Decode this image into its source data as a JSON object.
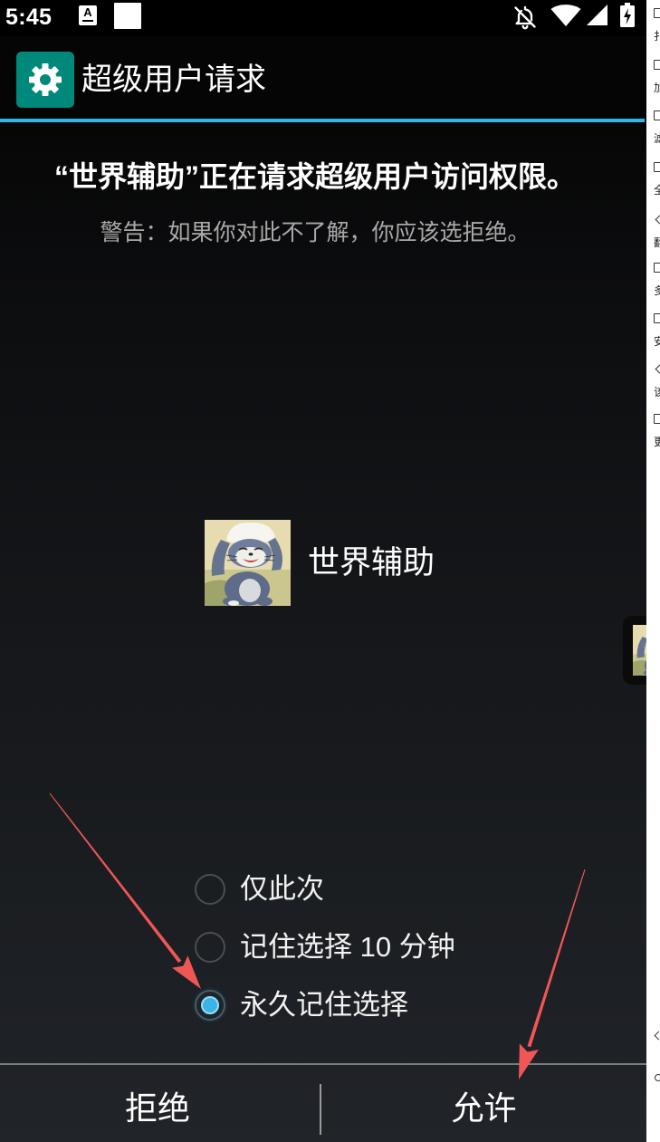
{
  "status_bar": {
    "time": "5:45",
    "notification_badge_letter": "A",
    "icons": [
      "a-text-icon",
      "white-square-icon",
      "bell-off-icon",
      "wifi-icon",
      "signal-icon",
      "battery-charging-icon"
    ]
  },
  "header": {
    "icon": "gear-icon",
    "title": "超级用户请求"
  },
  "request": {
    "heading": "“世界辅助”正在请求超级用户访问权限。",
    "warning": "警告：如果你对此不了解，你应该选拒绝。"
  },
  "app": {
    "icon": "cartoon-cat-app-icon",
    "name": "世界辅助"
  },
  "remember_options": [
    {
      "label": "仅此次",
      "selected": false
    },
    {
      "label": "记住选择 10 分钟",
      "selected": false
    },
    {
      "label": "永久记住选择",
      "selected": true
    }
  ],
  "actions": {
    "deny": "拒绝",
    "allow": "允许"
  },
  "side_panel": {
    "items": [
      {
        "icon": "box-icon",
        "label": "扌"
      },
      {
        "icon": "box-icon",
        "label": "加"
      },
      {
        "icon": "box-icon",
        "label": "滤"
      },
      {
        "icon": "box-icon",
        "label": "全"
      },
      {
        "icon": "chevron-icon",
        "label": "翻"
      },
      {
        "icon": "box-icon",
        "label": "多"
      },
      {
        "icon": "box-icon",
        "label": "安"
      },
      {
        "icon": "chevron-icon",
        "label": "该"
      },
      {
        "icon": "box-icon",
        "label": "更"
      }
    ],
    "nav_icons": [
      "nav-back-icon",
      "nav-home-icon"
    ]
  },
  "floating_window": {
    "icon": "cartoon-cat-thumbnail-icon"
  },
  "colors": {
    "accent": "#33b5e5",
    "gear_tile": "#00897b",
    "annotation_arrow": "#f05656",
    "radio_selected": "#3ab4e6"
  }
}
